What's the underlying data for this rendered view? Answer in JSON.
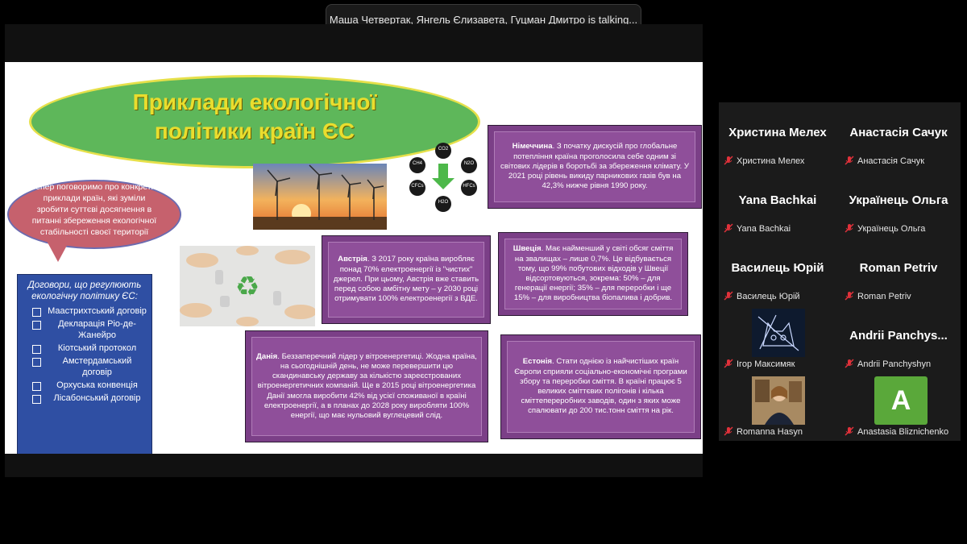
{
  "talking_banner": "Маша Четвертак, Янгель Єлизавета, Гуцман Дмитро is talking...",
  "slide": {
    "title_line1": "Приклади екологічної",
    "title_line2": "політики країн ЄС",
    "speech": "Тепер поговоримо про конкретні приклади країн, які зуміли зробити суттєві досягнення в питанні збереження екологічної стабільності своєї території",
    "treaty_title": "Договори, що регулюють екологічну політику ЄС:",
    "treaties": [
      "Маастрихтський договір",
      "Декларація Ріо-де-Жанейро",
      "Кіотський протокол",
      "Амстердамський договір",
      "Орхуська конвенція",
      "Лісабонський договір"
    ],
    "gases": {
      "top": "CO2",
      "left1": "CH4",
      "right1": "N2O",
      "left2": "CFCs",
      "right2": "HFCs",
      "bottom": "H2O"
    },
    "germany": {
      "country": "Німеччина",
      "text": ". З початку дискусій про глобальне потепління країна проголосила себе одним зі світових лідерів в боротьбі за збереження клімату. У 2021 році рівень викиду парникових газів був на 42,3% нижче рівня 1990 року."
    },
    "austria": {
      "country": "Австрія",
      "text": ". З 2017 року країна виробляє понад 70% електроенергії із \"чистих\" джерел. При цьому, Австрія вже ставить перед собою амбітну мету – у 2030 році отримувати 100% електроенергії з ВДЕ."
    },
    "sweden": {
      "country": "Швеція",
      "text": ". Має найменший у світі обсяг сміття на звалищах – лише 0,7%. Це відбувається тому, що 99% побутових відходів у Швеції відсортовуються, зокрема: 50% – для генерації енергії; 35% – для переробки і ще 15% – для виробництва біопалива і добрив."
    },
    "denmark": {
      "country": "Данія",
      "text": ". Беззаперечний лідер у вітроенергетиці. Жодна країна, на сьогоднішній день, не може перевершити цю скандинавську державу за кількістю зареєстрованих вітроенергетичних компаній. Ще в 2015 році вітроенергетика Данії змогла виробити 42% від усієї споживаної в країні електроенергії, а в планах до 2028 року виробляти 100% енергії, що має нульовий вуглецевий слід."
    },
    "estonia": {
      "country": "Естонія",
      "text": ". Стати однією із найчистіших країн Європи сприяли соціально-економічні програми збору та переробки сміття. В країні працює 5 великих сміттєвих полігонів і кілька сміттепереробних заводів, один з яких може спалювати до 200 тис.тонн сміття на рік."
    }
  },
  "participants": [
    {
      "big": "Христина Мелех",
      "name": "Христина Мелех"
    },
    {
      "big": "Анастасія Сачук",
      "name": "Анастасія Сачук"
    },
    {
      "big": "Yana Bachkai",
      "name": "Yana Bachkai"
    },
    {
      "big": "Українець Ольга",
      "name": "Українець Ольга"
    },
    {
      "big": "Василець Юрій",
      "name": "Василець Юрій"
    },
    {
      "big": "Roman Petriv",
      "name": "Roman Petriv"
    },
    {
      "big": "",
      "name": "Ігор Максимяк"
    },
    {
      "big": "Andrii Panchys...",
      "name": "Andrii Panchyshyn"
    },
    {
      "big": "",
      "name": "Romanna Hasyn"
    },
    {
      "big": "",
      "name": "Anastasia Bliznichenko",
      "avatar_letter": "A"
    }
  ],
  "colors": {
    "mic_muted": "#e0313a",
    "title_yellow": "#e9dd2e",
    "panel_purple": "#8f4f9a",
    "avatar_green": "#5aa83a"
  }
}
